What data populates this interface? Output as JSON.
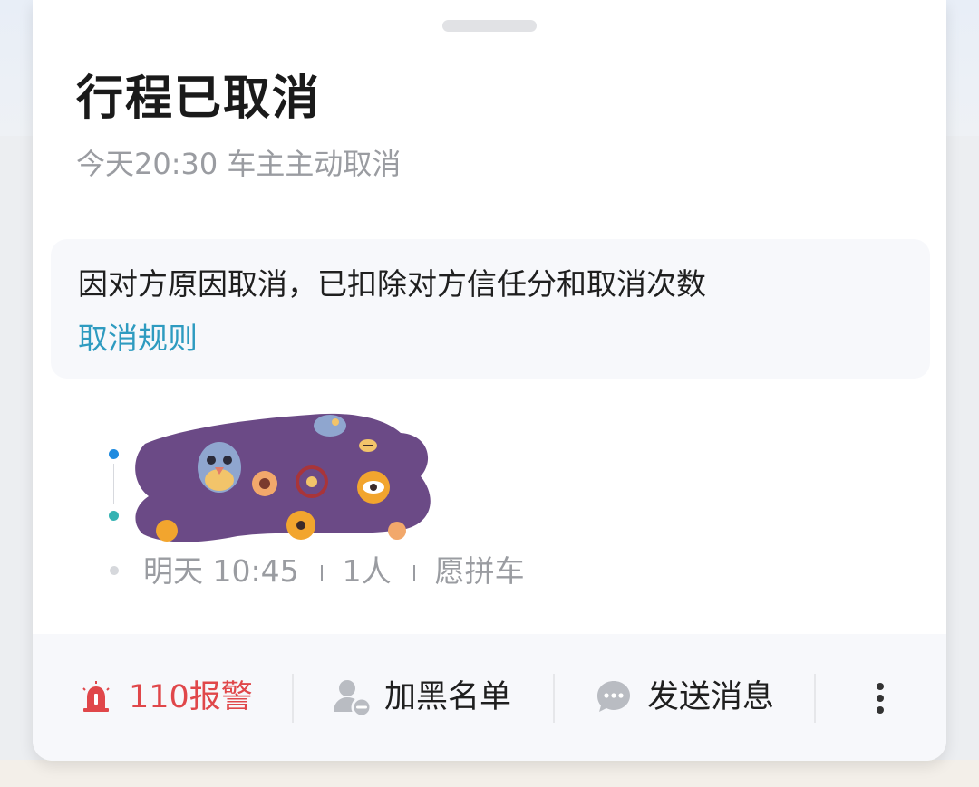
{
  "header": {
    "title": "行程已取消",
    "subtitle": "今天20:30 车主主动取消"
  },
  "notice": {
    "text": "因对方原因取消，已扣除对方信任分和取消次数",
    "rule_link": "取消规则",
    "link_color": "#2e9bc0"
  },
  "trip": {
    "time": "明天 10:45",
    "passengers": "1人",
    "carpool": "愿拼车",
    "start_dot_color": "#1f8be0",
    "end_dot_color": "#35b3b3"
  },
  "actions": {
    "alarm": {
      "label": "110报警",
      "icon": "alarm-siren-icon",
      "color": "#e0474a"
    },
    "blacklist": {
      "label": "加黑名单",
      "icon": "user-block-icon"
    },
    "message": {
      "label": "发送消息",
      "icon": "chat-bubble-icon"
    },
    "more": {
      "icon": "more-vertical-icon"
    }
  }
}
